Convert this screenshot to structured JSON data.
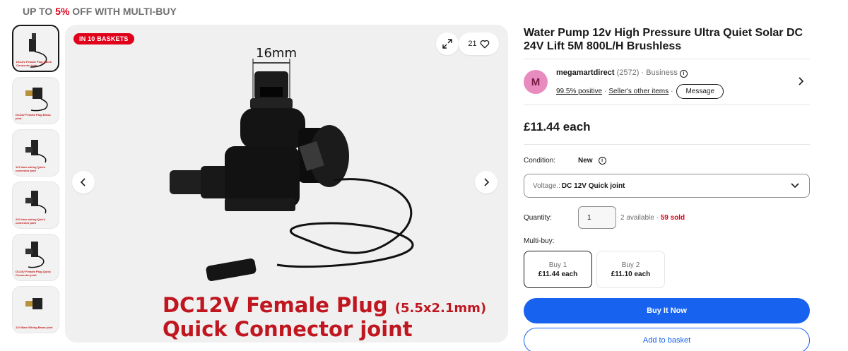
{
  "promo": {
    "prefix": "UP TO ",
    "percent": "5%",
    "suffix": " OFF WITH MULTI-BUY"
  },
  "gallery": {
    "badge": "IN 10 BASKETS",
    "fav_count": "21",
    "dimension_label": "16mm",
    "caption_line1": "DC12V Female Plug ",
    "caption_line1_small": "(5.5x2.1mm)",
    "caption_line2": "Quick Connector joint",
    "thumbnails": [
      {
        "caption": "DC12V Female Plug Quick Connector joint"
      },
      {
        "caption": "DC24V Female Plug Brass joint"
      },
      {
        "caption": "12V bare wiring Quick connector joint"
      },
      {
        "caption": "24V bare wiring Quick connector joint"
      },
      {
        "caption": "DC24V Female Plug Quick Connector joint"
      },
      {
        "caption": "12V Bare Wiring Brass joint"
      }
    ]
  },
  "product": {
    "title": "Water Pump 12v High Pressure Ultra Quiet Solar DC 24V Lift 5M 800L/H Brushless",
    "price": "£11.44 each"
  },
  "seller": {
    "avatar_letter": "M",
    "name": "megamartdirect",
    "feedback_count": "(2572)",
    "type": "· Business",
    "positive": "99.5% positive",
    "other_items": "Seller's other items",
    "message_label": "Message"
  },
  "condition": {
    "label": "Condition:",
    "value": "New"
  },
  "variant": {
    "key": "Voltage.:",
    "value": "DC 12V Quick joint"
  },
  "quantity": {
    "label": "Quantity:",
    "value": "1",
    "available": "2 available ·",
    "sold": "59 sold"
  },
  "multibuy": {
    "label": "Multi-buy:",
    "options": [
      {
        "title": "Buy 1",
        "price": "£11.44 each",
        "selected": true
      },
      {
        "title": "Buy 2",
        "price": "£11.10 each",
        "selected": false
      }
    ]
  },
  "actions": {
    "buy_now": "Buy It Now",
    "add_to_basket": "Add to basket"
  },
  "colors": {
    "accent": "#1862f0",
    "sale_red": "#e0001a",
    "avatar": "#e88cc0"
  }
}
